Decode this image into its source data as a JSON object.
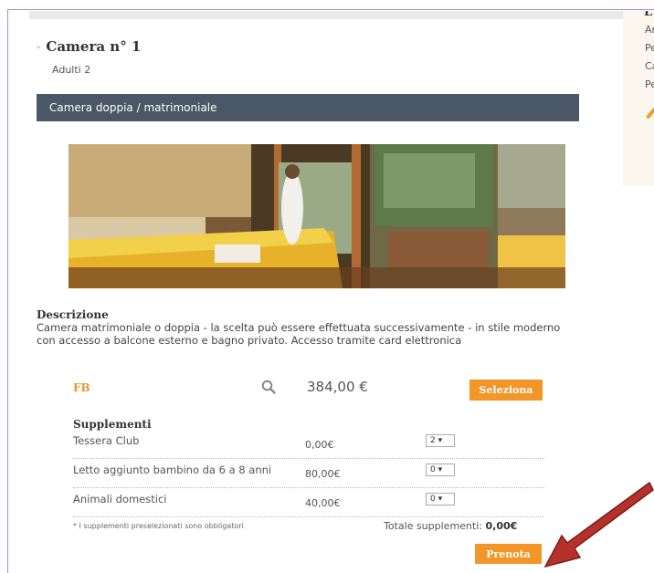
{
  "room": {
    "title": "Camera n° 1",
    "adults": "Adulti 2",
    "type": "Camera doppia / matrimoniale"
  },
  "sidepanel": {
    "head": "L",
    "lines": [
      "Ar",
      "Pe",
      "Ca",
      "Pe"
    ]
  },
  "description": {
    "title": "Descrizione",
    "text": "Camera matrimoniale o doppia - la scelta può essere effettuata successivamente - in stile moderno con accesso a balcone esterno e bagno privato. Accesso tramite card elettronica"
  },
  "rate": {
    "code": "FB",
    "price": "384,00 €",
    "select_label": "Seleziona"
  },
  "supplements": {
    "title": "Supplementi",
    "items": [
      {
        "name": "Tessera Club",
        "price": "0,00€",
        "qty": "2"
      },
      {
        "name": "Letto aggiunto bambino da 6 a 8 anni",
        "price": "80,00€",
        "qty": "0"
      },
      {
        "name": "Animali domestici",
        "price": "40,00€",
        "qty": "0"
      }
    ],
    "note": "* I supplementi preselezionati sono obbligatori",
    "total_label": "Totale supplementi:",
    "total_value": "0,00€"
  },
  "book_label": "Prenota",
  "icons": {
    "magnifier": "search-icon",
    "chevron": "chevron-down-icon",
    "pencil": "pencil-icon",
    "arrow": "pointer-arrow"
  },
  "colors": {
    "accent": "#f29627",
    "bar": "#4a5767"
  }
}
